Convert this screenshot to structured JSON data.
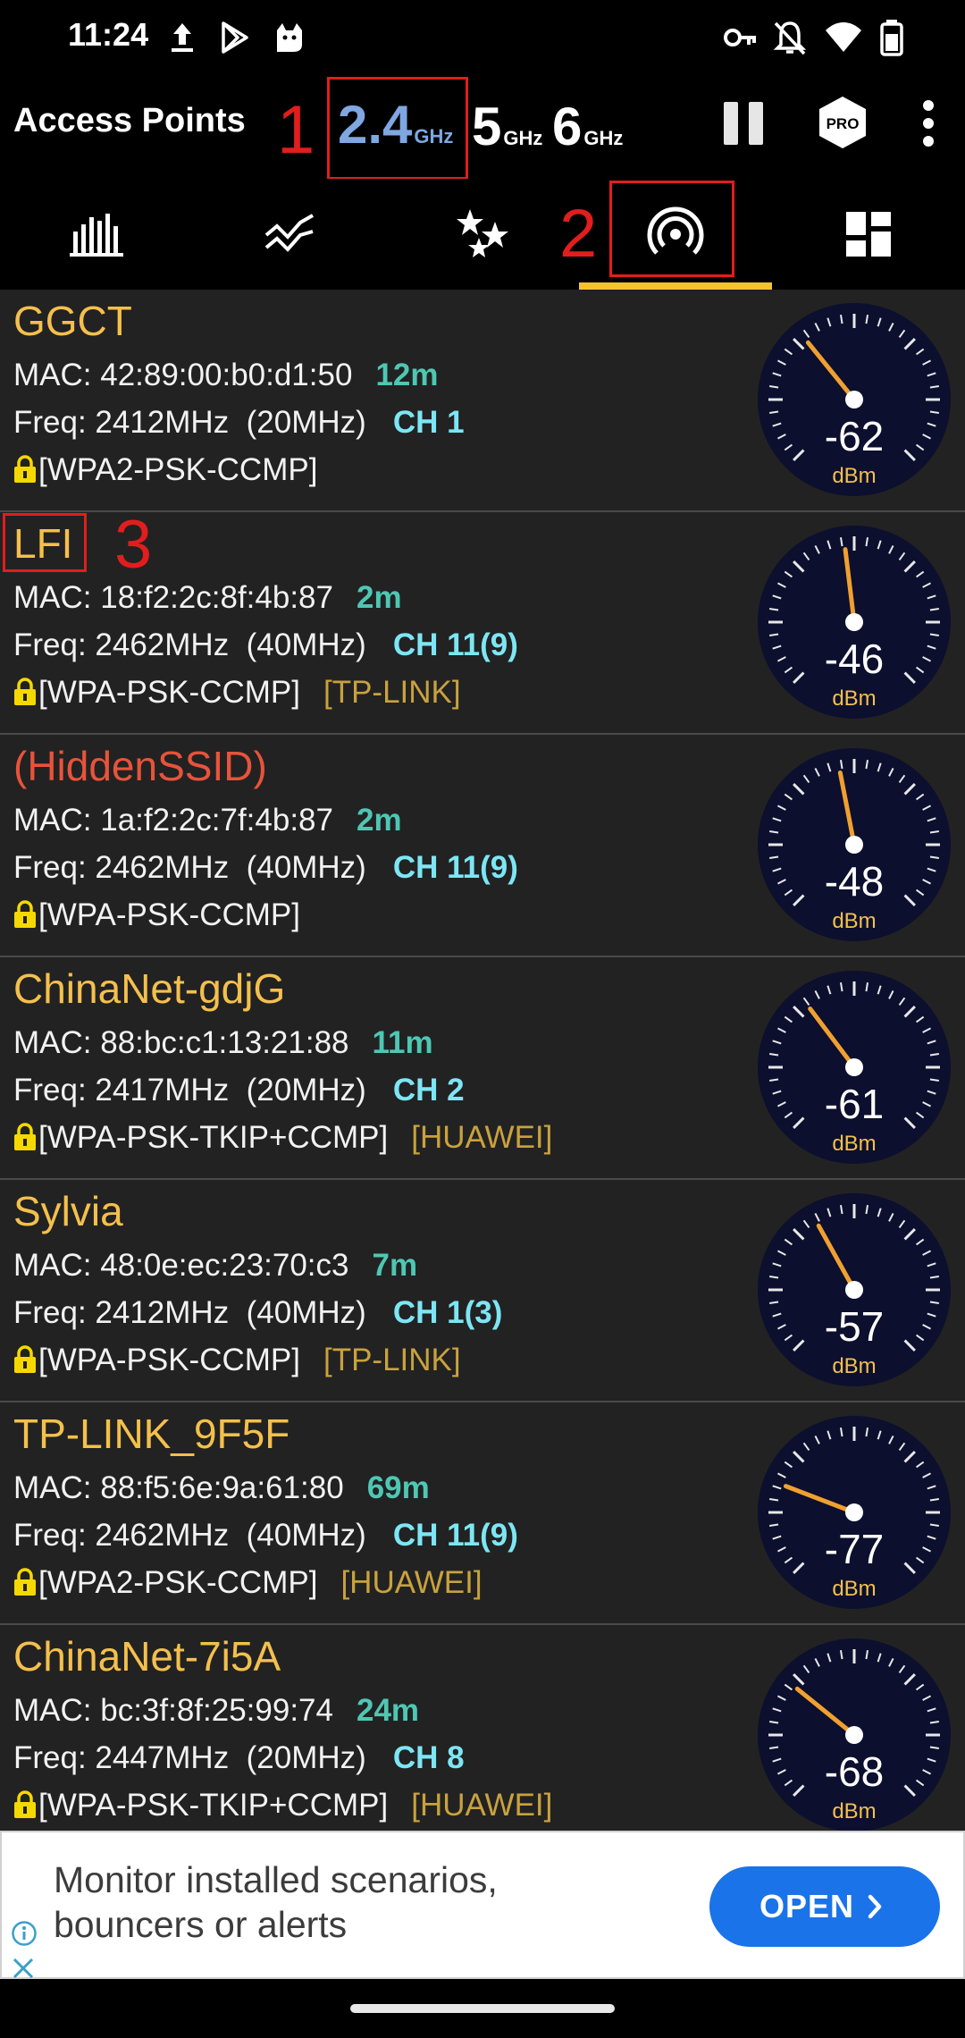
{
  "status_bar": {
    "time": "11:24",
    "left_icons": [
      "upload-icon",
      "play-store-icon",
      "cat-icon"
    ],
    "right_icons": [
      "vpn-key-icon",
      "notifications-off-icon",
      "wifi-icon",
      "battery-icon"
    ]
  },
  "app_bar": {
    "title": "Access Points",
    "bands": [
      {
        "value": "2.4",
        "unit": "GHz",
        "active": true
      },
      {
        "value": "5",
        "unit": "GHz",
        "active": false
      },
      {
        "value": "6",
        "unit": "GHz",
        "active": false
      }
    ],
    "pro_label": "PRO",
    "actions": [
      "pause-icon",
      "pro-badge",
      "more-vert-icon"
    ]
  },
  "annotations": {
    "marker1": "1",
    "marker2": "2",
    "marker3": "3"
  },
  "tabs": [
    {
      "name": "channel-graph",
      "icon": "bar-chart-icon"
    },
    {
      "name": "time-graph",
      "icon": "trend-graph-icon"
    },
    {
      "name": "channel-rating",
      "icon": "stars-icon"
    },
    {
      "name": "access-points",
      "icon": "wifi-tethering-icon",
      "selected": true
    },
    {
      "name": "dashboard",
      "icon": "dashboard-icon"
    }
  ],
  "access_points": [
    {
      "ssid": "GGCT",
      "mac": "MAC: 42:89:00:b0:d1:50",
      "distance": "12m",
      "freq": "Freq: 2412MHz  (20MHz)",
      "channel": "CH 1",
      "security": "[WPA2-PSK-CCMP]",
      "vendor": "",
      "signal": -62,
      "signal_label": "-62",
      "unit": "dBm"
    },
    {
      "ssid": "LFI",
      "mac": "MAC: 18:f2:2c:8f:4b:87",
      "distance": "2m",
      "freq": "Freq: 2462MHz  (40MHz)",
      "channel": "CH 11(9)",
      "security": "[WPA-PSK-CCMP]",
      "vendor": "[TP-LINK]",
      "signal": -46,
      "signal_label": "-46",
      "unit": "dBm"
    },
    {
      "ssid": "(HiddenSSID)",
      "hidden": true,
      "mac": "MAC: 1a:f2:2c:7f:4b:87",
      "distance": "2m",
      "freq": "Freq: 2462MHz  (40MHz)",
      "channel": "CH 11(9)",
      "security": "[WPA-PSK-CCMP]",
      "vendor": "",
      "signal": -48,
      "signal_label": "-48",
      "unit": "dBm"
    },
    {
      "ssid": "ChinaNet-gdjG",
      "mac": "MAC: 88:bc:c1:13:21:88",
      "distance": "11m",
      "freq": "Freq: 2417MHz  (20MHz)",
      "channel": "CH 2",
      "security": "[WPA-PSK-TKIP+CCMP]",
      "vendor": "[HUAWEI]",
      "signal": -61,
      "signal_label": "-61",
      "unit": "dBm"
    },
    {
      "ssid": "Sylvia",
      "mac": "MAC: 48:0e:ec:23:70:c3",
      "distance": "7m",
      "freq": "Freq: 2412MHz  (40MHz)",
      "channel": "CH 1(3)",
      "security": "[WPA-PSK-CCMP]",
      "vendor": "[TP-LINK]",
      "signal": -57,
      "signal_label": "-57",
      "unit": "dBm"
    },
    {
      "ssid": "TP-LINK_9F5F",
      "mac": "MAC: 88:f5:6e:9a:61:80",
      "distance": "69m",
      "freq": "Freq: 2462MHz  (40MHz)",
      "channel": "CH 11(9)",
      "security": "[WPA2-PSK-CCMP]",
      "vendor": "[HUAWEI]",
      "signal": -77,
      "signal_label": "-77",
      "unit": "dBm"
    },
    {
      "ssid": "ChinaNet-7i5A",
      "mac": "MAC: bc:3f:8f:25:99:74",
      "distance": "24m",
      "freq": "Freq: 2447MHz  (20MHz)",
      "channel": "CH 8",
      "security": "[WPA-PSK-TKIP+CCMP]",
      "vendor": "[HUAWEI]",
      "signal": -68,
      "signal_label": "-68",
      "unit": "dBm"
    }
  ],
  "ad": {
    "line1": "Monitor installed scenarios,",
    "line2": "bouncers or alerts",
    "button": "OPEN",
    "icons": [
      "info-icon",
      "close-icon",
      "chevron-right-icon"
    ]
  },
  "colors": {
    "ssid": "#f4c04c",
    "hidden_ssid": "#e8533b",
    "distance": "#4ec7b3",
    "channel": "#7de6f4",
    "vendor": "#c9a23e",
    "active_band": "#7fa7e2",
    "tab_indicator": "#f4c430",
    "needle": "#f0a030",
    "annotation": "#e21d1d",
    "ad_button": "#1a73e8"
  }
}
